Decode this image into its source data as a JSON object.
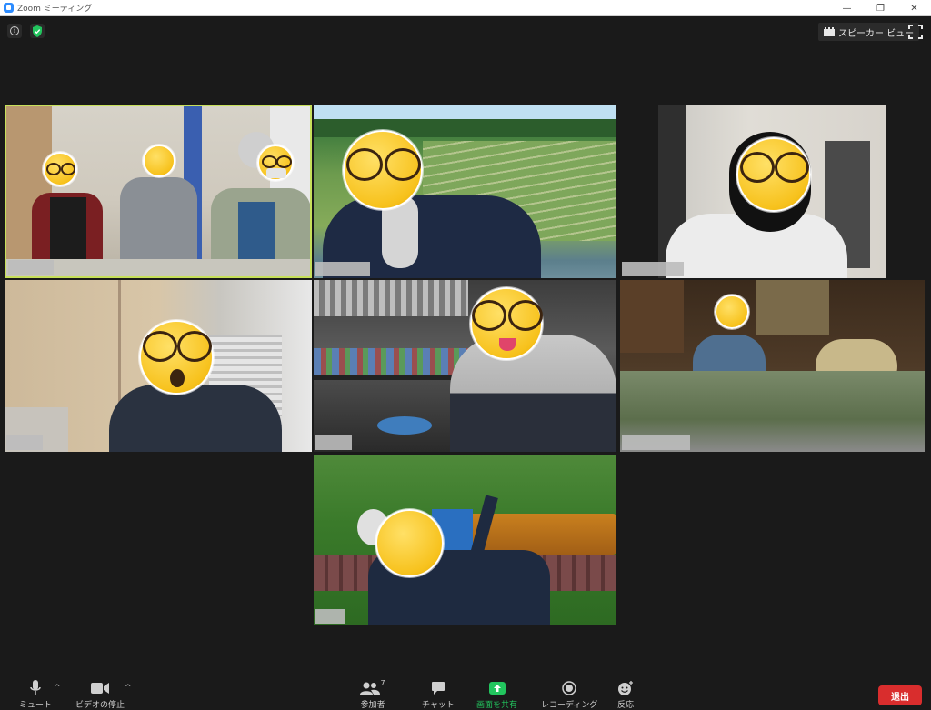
{
  "window": {
    "title": "Zoom ミーティング",
    "controls": [
      "—",
      "❐",
      "✕"
    ]
  },
  "topbar": {
    "info_icon": "info-icon",
    "encryption_icon": "shield-check-icon",
    "encryption_color": "#22c55e",
    "speaker_view_label": "スピーカー ビュー",
    "fullscreen_icon": "fullscreen-icon"
  },
  "participants": [
    {
      "tile": "tile-1",
      "active": true,
      "scene": "three people in room",
      "name_hidden": true
    },
    {
      "tile": "tile-2",
      "active": false,
      "scene": "man with vineyard background",
      "name_hidden": true
    },
    {
      "tile": "tile-3",
      "active": false,
      "scene": "man indoors",
      "name_hidden": true
    },
    {
      "tile": "tile-4",
      "active": false,
      "scene": "man with cabinet behind",
      "name_hidden": true
    },
    {
      "tile": "tile-5",
      "active": false,
      "scene": "man in hoodie with shelf",
      "name_hidden": true
    },
    {
      "tile": "tile-6",
      "active": false,
      "scene": "man in living room with model railway",
      "name_hidden": true
    },
    {
      "tile": "tile-7",
      "active": false,
      "scene": "man with train background",
      "name_hidden": true
    }
  ],
  "toolbar": {
    "mute_label": "ミュート",
    "video_label": "ビデオの停止",
    "participants_label": "参加者",
    "participants_count": "7",
    "chat_label": "チャット",
    "share_label": "画面を共有",
    "share_color": "#22c55e",
    "record_label": "レコーディング",
    "reactions_label": "反応",
    "leave_label": "退出",
    "leave_color": "#d92d2d"
  }
}
